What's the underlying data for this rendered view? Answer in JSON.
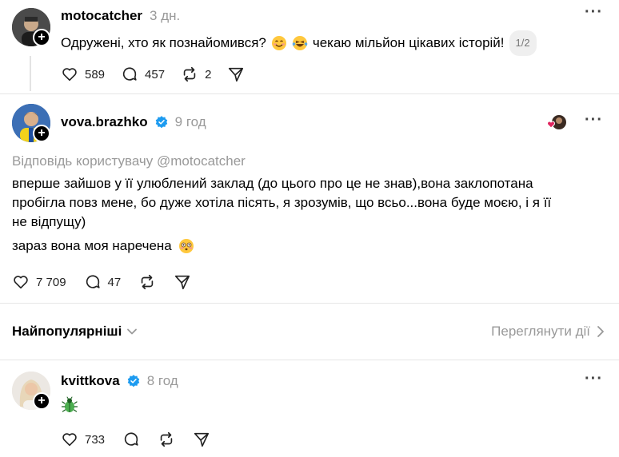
{
  "post1": {
    "username": "motocatcher",
    "time": "3 дн.",
    "text": "Одружені, хто як познайомився?",
    "text_after": "чекаю мільйон цікавих історій!",
    "page_badge": "1/2",
    "likes": "589",
    "comments": "457",
    "reposts": "2"
  },
  "post2": {
    "username": "vova.brazhko",
    "time": "9 год",
    "reply_prefix": "Відповідь користувачу @motocatcher",
    "text_line1": "вперше зайшов у її улюблений заклад (до цього про це не знав),вона заклопотана",
    "text_line2": "пробігла повз мене, бо дуже хотіла пісять, я зрозумів, що всьо...вона буде моєю, і я її",
    "text_line3": "не відпущу)",
    "text_line4": "зараз вона моя наречена",
    "likes": "7 709",
    "comments": "47"
  },
  "sort": {
    "label": "Найпопулярніші",
    "view_activity": "Переглянути дії"
  },
  "post3": {
    "username": "kvittkova",
    "time": "8 год",
    "likes": "733"
  },
  "colors": {
    "verified": "#1d9bf0",
    "muted": "#999999",
    "heart_red": "#e0245e"
  }
}
